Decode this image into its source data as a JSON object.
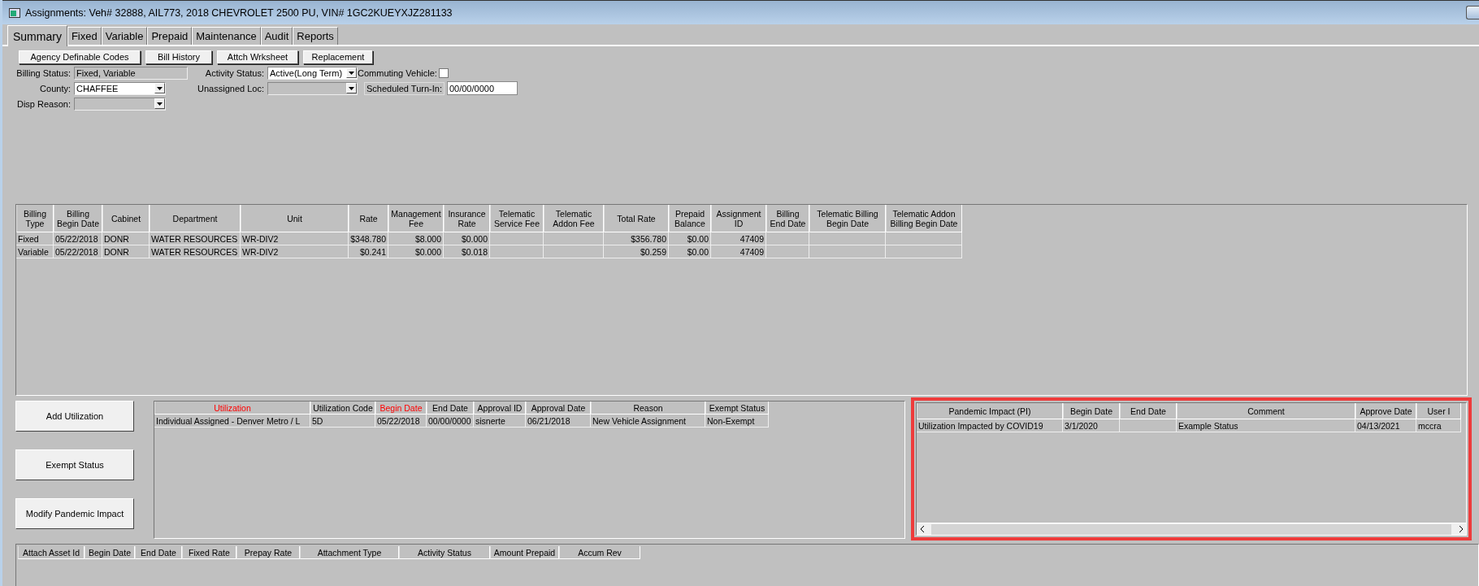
{
  "window": {
    "title": "Assignments: Veh# 32888, AIL773, 2018 CHEVROLET 2500 PU, VIN# 1GC2KUEYXJZ281133"
  },
  "tabs": [
    {
      "label": "Summary",
      "selected": true
    },
    {
      "label": "Fixed",
      "selected": false
    },
    {
      "label": "Variable",
      "selected": false
    },
    {
      "label": "Prepaid",
      "selected": false
    },
    {
      "label": "Maintenance",
      "selected": false
    },
    {
      "label": "Audit",
      "selected": false
    },
    {
      "label": "Reports",
      "selected": false
    }
  ],
  "toolbar_buttons": [
    "Agency Definable Codes",
    "Bill History",
    "Attch Wrksheet",
    "Replacement"
  ],
  "form": {
    "billing_status": {
      "label": "Billing Status:",
      "value": "Fixed, Variable"
    },
    "activity_status": {
      "label": "Activity Status:",
      "value": "Active(Long Term)"
    },
    "commuting_vehicle": {
      "label": "Commuting Vehicle:",
      "checked": false
    },
    "county": {
      "label": "County:",
      "value": "CHAFFEE"
    },
    "unassigned_loc": {
      "label": "Unassigned Loc:"
    },
    "scheduled_turn_in": {
      "label": "Scheduled Turn-In:",
      "value": "00/00/0000"
    },
    "disp_reason": {
      "label": "Disp Reason:"
    }
  },
  "billing_table": {
    "columns": [
      "Billing Type",
      "Billing Begin Date",
      "Cabinet",
      "Department",
      "Unit",
      "Rate",
      "Management Fee",
      "Insurance Rate",
      "Telematic Service Fee",
      "Telematic Addon Fee",
      "Total Rate",
      "Prepaid Balance",
      "Assignment ID",
      "Billing End Date",
      "Telematic Billing Begin Date",
      "Telematic Addon Billing Begin Date"
    ],
    "rows": [
      [
        "Fixed",
        "05/22/2018",
        "DONR",
        "WATER RESOURCES",
        "WR-DIV2",
        "$348.780",
        "$8.000",
        "$0.000",
        "",
        "",
        "$356.780",
        "$0.00",
        "47409",
        "",
        "",
        ""
      ],
      [
        "Variable",
        "05/22/2018",
        "DONR",
        "WATER RESOURCES",
        "WR-DIV2",
        "$0.241",
        "$0.000",
        "$0.018",
        "",
        "",
        "$0.259",
        "$0.00",
        "47409",
        "",
        "",
        ""
      ]
    ]
  },
  "utilization_buttons": [
    "Add Utilization",
    "Exempt Status",
    "Modify Pandemic Impact"
  ],
  "utilization_table": {
    "columns": [
      {
        "label": "Utilization",
        "highlighted": true
      },
      {
        "label": "Utilization Code",
        "highlighted": false
      },
      {
        "label": "Begin Date",
        "highlighted": true
      },
      {
        "label": "End Date",
        "highlighted": false
      },
      {
        "label": "Approval ID",
        "highlighted": false
      },
      {
        "label": "Approval Date",
        "highlighted": false
      },
      {
        "label": "Reason",
        "highlighted": false
      },
      {
        "label": "Exempt Status",
        "highlighted": false
      }
    ],
    "rows": [
      [
        "Individual Assigned - Denver Metro / L",
        "5D",
        "05/22/2018",
        "00/00/0000",
        "sisnerte",
        "06/21/2018",
        "New Vehicle Assignment",
        "Non-Exempt"
      ]
    ]
  },
  "pandemic_table": {
    "columns": [
      "Pandemic Impact (PI)",
      "Begin Date",
      "End Date",
      "Comment",
      "Approve Date",
      "User I"
    ],
    "rows": [
      [
        "Utilization Impacted by COVID19",
        "3/1/2020",
        "",
        "Example Status",
        "04/13/2021",
        "mccra"
      ]
    ]
  },
  "attachment_table": {
    "columns": [
      "Attach Asset Id",
      "Begin Date",
      "End Date",
      "Fixed Rate",
      "Prepay Rate",
      "Attachment Type",
      "Activity Status",
      "Amount Prepaid",
      "Accum Rev"
    ]
  }
}
